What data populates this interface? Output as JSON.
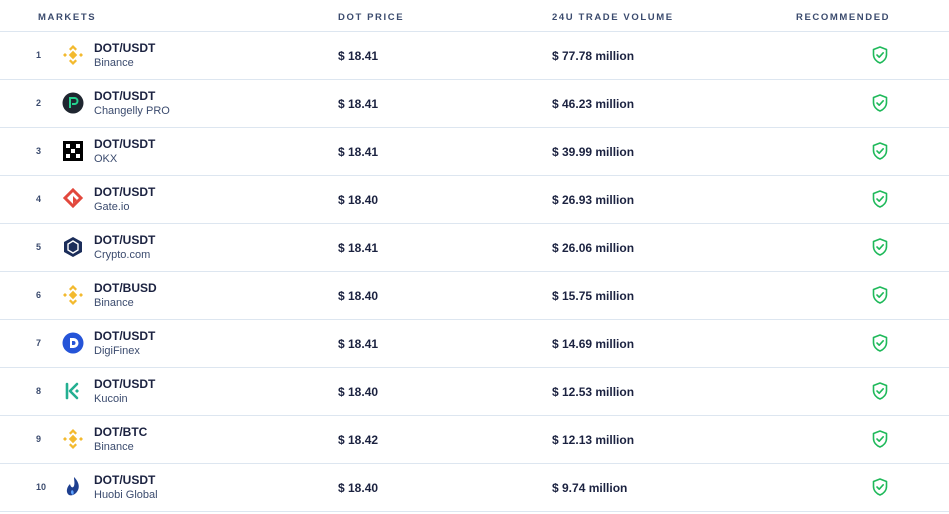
{
  "header": {
    "markets": "MARKETS",
    "price": "DOT PRICE",
    "volume": "24U TRADE VOLUME",
    "recommended": "RECOMMENDED"
  },
  "colors": {
    "check_green": "#1fb95a",
    "binance_yellow": "#f3ba2f",
    "gate_red": "#e2483d",
    "crypto_navy": "#1b2d5a",
    "digifinex_blue": "#2554d8",
    "kucoin_teal": "#23af91",
    "huobi_blue": "#1e3f8f"
  },
  "rows": [
    {
      "rank": "1",
      "logo": "binance-icon",
      "pair": "DOT/USDT",
      "exchange": "Binance",
      "price": "$ 18.41",
      "volume": "$ 77.78 million",
      "recommended": "shield-check-icon"
    },
    {
      "rank": "2",
      "logo": "changelly-pro-icon",
      "pair": "DOT/USDT",
      "exchange": "Changelly PRO",
      "price": "$ 18.41",
      "volume": "$ 46.23 million",
      "recommended": "shield-check-icon"
    },
    {
      "rank": "3",
      "logo": "okx-icon",
      "pair": "DOT/USDT",
      "exchange": "OKX",
      "price": "$ 18.41",
      "volume": "$ 39.99 million",
      "recommended": "shield-check-icon"
    },
    {
      "rank": "4",
      "logo": "gate-io-icon",
      "pair": "DOT/USDT",
      "exchange": "Gate.io",
      "price": "$ 18.40",
      "volume": "$ 26.93 million",
      "recommended": "shield-check-icon"
    },
    {
      "rank": "5",
      "logo": "crypto-com-icon",
      "pair": "DOT/USDT",
      "exchange": "Crypto.com",
      "price": "$ 18.41",
      "volume": "$ 26.06 million",
      "recommended": "shield-check-icon"
    },
    {
      "rank": "6",
      "logo": "binance-icon",
      "pair": "DOT/BUSD",
      "exchange": "Binance",
      "price": "$ 18.40",
      "volume": "$ 15.75 million",
      "recommended": "shield-check-icon"
    },
    {
      "rank": "7",
      "logo": "digifinex-icon",
      "pair": "DOT/USDT",
      "exchange": "DigiFinex",
      "price": "$ 18.41",
      "volume": "$ 14.69 million",
      "recommended": "shield-check-icon"
    },
    {
      "rank": "8",
      "logo": "kucoin-icon",
      "pair": "DOT/USDT",
      "exchange": "Kucoin",
      "price": "$ 18.40",
      "volume": "$ 12.53 million",
      "recommended": "shield-check-icon"
    },
    {
      "rank": "9",
      "logo": "binance-icon",
      "pair": "DOT/BTC",
      "exchange": "Binance",
      "price": "$ 18.42",
      "volume": "$ 12.13 million",
      "recommended": "shield-check-icon"
    },
    {
      "rank": "10",
      "logo": "huobi-global-icon",
      "pair": "DOT/USDT",
      "exchange": "Huobi Global",
      "price": "$ 18.40",
      "volume": "$ 9.74 million",
      "recommended": "shield-check-icon"
    }
  ]
}
